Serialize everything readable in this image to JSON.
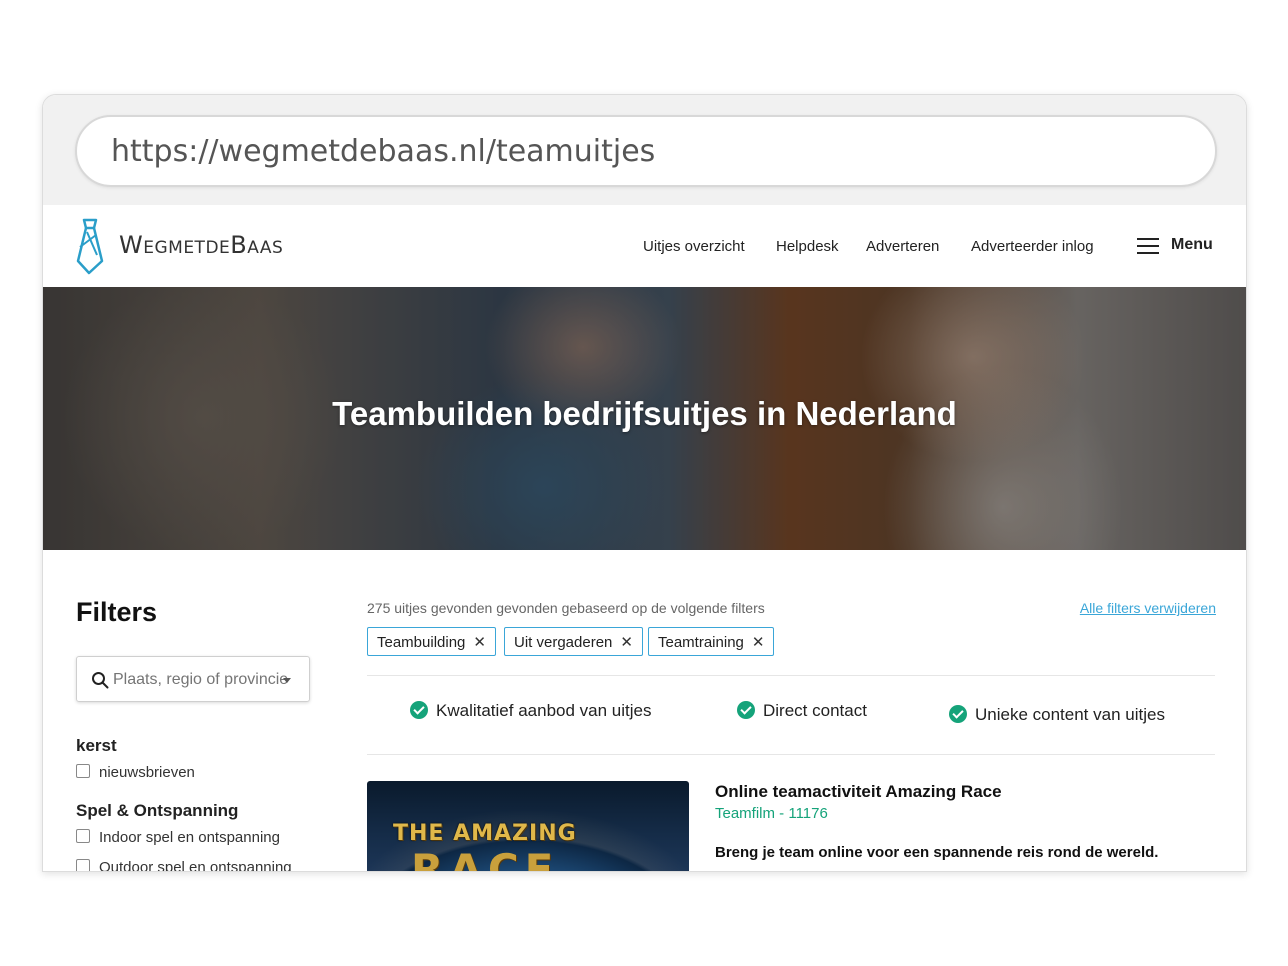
{
  "browser": {
    "url": "https://wegmetdebaas.nl/teamuitjes"
  },
  "header": {
    "logo_text": "WegmetdeBaas",
    "nav": [
      "Uitjes overzicht",
      "Helpdesk",
      "Adverteren",
      "Adverteerder inlog"
    ],
    "menu_label": "Menu"
  },
  "hero": {
    "title": "Teambuilden bedrijfsuitjes in Nederland"
  },
  "sidebar": {
    "title": "Filters",
    "search_placeholder": "Plaats, regio of provincie",
    "categories": [
      {
        "title": "kerst",
        "options": [
          "nieuwsbrieven"
        ]
      },
      {
        "title": "Spel & Ontspanning",
        "options": [
          "Indoor spel en ontspanning",
          "Outdoor spel en ontspanning"
        ]
      }
    ]
  },
  "results": {
    "summary": "275 uitjes gevonden gevonden gebaseerd op de volgende filters",
    "clear_all": "Alle filters verwijderen",
    "active_filters": [
      "Teambuilding",
      "Uit vergaderen",
      "Teamtraining"
    ],
    "usps": [
      "Kwalitatief aanbod van uitjes",
      "Direct contact",
      "Unieke content van uitjes"
    ]
  },
  "card": {
    "image_text_1": "THE AMAZING",
    "image_text_2": "RACE",
    "title": "Online teamactiviteit Amazing Race",
    "subtitle": "Teamfilm - 11176",
    "description": "Breng je team online voor een spannende reis rond de wereld."
  },
  "colors": {
    "accent_green": "#15a37a",
    "accent_blue": "#3aa6d8"
  }
}
